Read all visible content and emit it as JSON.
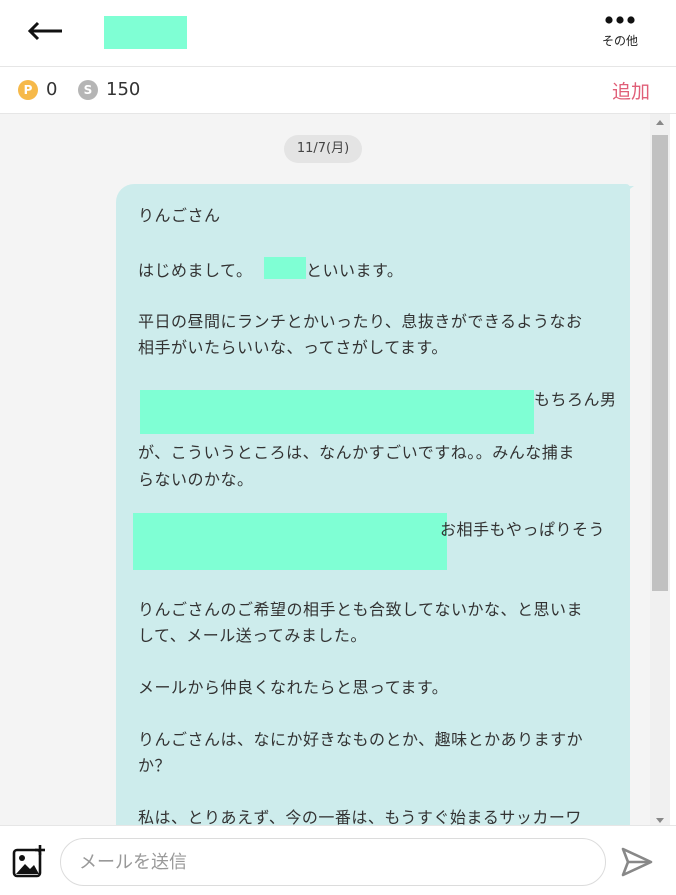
{
  "header": {
    "more_label": "その他"
  },
  "points": {
    "p_label": "P",
    "p_value": "0",
    "s_label": "S",
    "s_value": "150",
    "add_label": "追加"
  },
  "chat": {
    "date": "11/7(月)",
    "message_lines": [
      "りんごさん",
      "はじめまして。",
      "といいます。",
      "平日の昼間にランチとかいったり、息抜きができるようなお",
      "相手がいたらいいな、ってさがしてます。",
      "もちろん男",
      "が、こういうところは、なんかすごいですね。。みんな捕ま",
      "らないのかな。",
      "お相手もやっぱりそう",
      "りんごさんのご希望の相手とも合致してないかな、と思いま",
      "して、メール送ってみました。",
      "メールから仲良くなれたらと思ってます。",
      "りんごさんは、なにか好きなものとか、趣味とかありますか",
      "か？",
      "私は、とりあえず、今の一番は、もうすぐ始まるサッカーワ"
    ]
  },
  "composer": {
    "placeholder": "メールを送信"
  }
}
